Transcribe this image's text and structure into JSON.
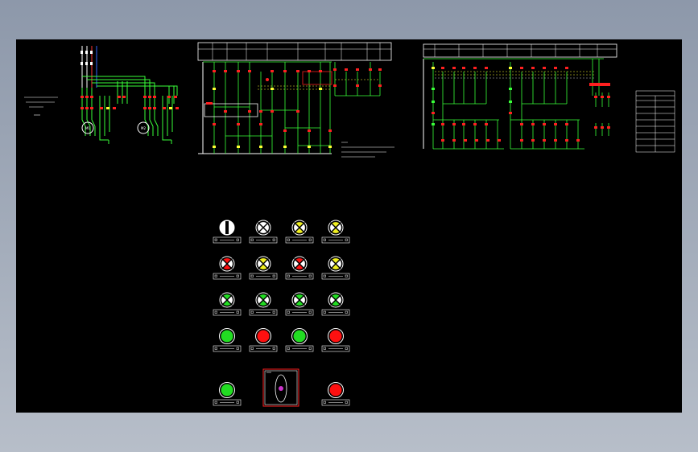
{
  "colors": {
    "background": "#000000",
    "wire_green": "#39ff39",
    "wire_yellow": "#ffff33",
    "wire_white": "#ffffff",
    "contact_red": "#ff2020",
    "lamp_green": "#22dd22",
    "lamp_red": "#ff1010",
    "lamp_yellow": "#f0f020",
    "frame_red": "#ff2020",
    "selector_magenta": "#cc33cc"
  },
  "motors": [
    {
      "label": "M1"
    },
    {
      "label": "M2"
    }
  ],
  "indicators": {
    "rows": [
      [
        {
          "type": "knob",
          "color": "white"
        },
        {
          "type": "cross",
          "color": "white"
        },
        {
          "type": "cross",
          "color": "yellow"
        },
        {
          "type": "cross",
          "color": "yellow"
        }
      ],
      [
        {
          "type": "cross",
          "color": "red"
        },
        {
          "type": "cross",
          "color": "yellow"
        },
        {
          "type": "cross",
          "color": "red"
        },
        {
          "type": "cross",
          "color": "yellow"
        }
      ],
      [
        {
          "type": "cross",
          "color": "green"
        },
        {
          "type": "cross",
          "color": "green"
        },
        {
          "type": "cross",
          "color": "green"
        },
        {
          "type": "cross",
          "color": "green"
        }
      ],
      [
        {
          "type": "button",
          "color": "green"
        },
        {
          "type": "button",
          "color": "red"
        },
        {
          "type": "button",
          "color": "green"
        },
        {
          "type": "button",
          "color": "red"
        }
      ]
    ],
    "bottom": [
      {
        "type": "button",
        "color": "green"
      },
      {
        "type": "selector",
        "color": "magenta"
      },
      {
        "type": "button",
        "color": "red"
      }
    ]
  }
}
